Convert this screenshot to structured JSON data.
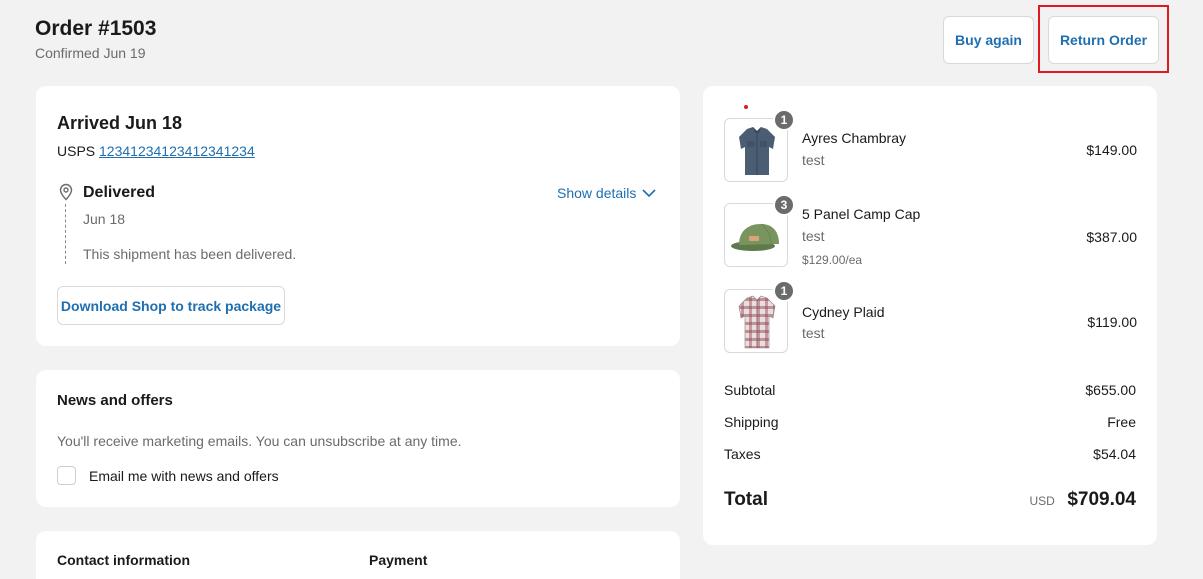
{
  "header": {
    "title": "Order #1503",
    "subtitle": "Confirmed Jun 19",
    "buy_again": "Buy again",
    "return_order": "Return Order"
  },
  "shipment": {
    "status_title": "Arrived Jun 18",
    "carrier": "USPS",
    "tracking_number": "12341234123412341234",
    "event_title": "Delivered",
    "event_date": "Jun 18",
    "event_message": "This shipment has been delivered.",
    "show_details": "Show details",
    "download_button": "Download Shop to track package"
  },
  "news": {
    "title": "News and offers",
    "text": "You'll receive marketing emails. You can unsubscribe at any time.",
    "checkbox_label": "Email me with news and offers",
    "checked": false
  },
  "contact": {
    "contact_heading": "Contact information",
    "payment_heading": "Payment"
  },
  "items": [
    {
      "name": "Ayres Chambray",
      "variant": "test",
      "quantity": "1",
      "price": "$149.00",
      "unit_price": ""
    },
    {
      "name": "5 Panel Camp Cap",
      "variant": "test",
      "quantity": "3",
      "price": "$387.00",
      "unit_price": "$129.00/ea"
    },
    {
      "name": "Cydney Plaid",
      "variant": "test",
      "quantity": "1",
      "price": "$119.00",
      "unit_price": ""
    }
  ],
  "summary": {
    "subtotal_label": "Subtotal",
    "subtotal": "$655.00",
    "shipping_label": "Shipping",
    "shipping": "Free",
    "taxes_label": "Taxes",
    "taxes": "$54.04",
    "total_label": "Total",
    "currency": "USD",
    "total": "$709.04"
  },
  "colors": {
    "accent": "#1f6fb0",
    "highlight": "#e0191f",
    "background": "#f2f2f2"
  }
}
